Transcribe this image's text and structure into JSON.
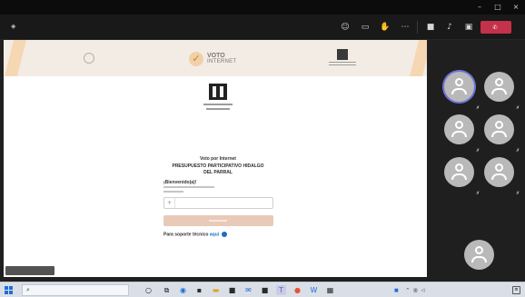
{
  "titlebar": {
    "title": "",
    "minimize": "–",
    "maximize": "□",
    "close": "×"
  },
  "toolbar": {
    "timer": "",
    "icons": [
      "people-icon",
      "chat-icon",
      "reactions-icon",
      "more-icon",
      "camera-icon",
      "mic-icon",
      "share-icon"
    ],
    "leave_label": ""
  },
  "site": {
    "logo_left_text": "",
    "logo_center_line1": "VOTO",
    "logo_center_highlight": "",
    "logo_center_line2": "INTERNET",
    "heading_small": "Voto por Internet",
    "heading_big_1": "PRESUPUESTO PARTICIPATIVO HIDALGO",
    "heading_big_2": "DEL PARRAL",
    "welcome": "¡Bienvenido(a)!",
    "input_placeholder": "",
    "help_text": "Para soporte técnico",
    "help_link": "aquí"
  },
  "presenter": {
    "name": ""
  },
  "participants": [
    {
      "name": "",
      "active": true
    },
    {
      "name": "",
      "active": false
    },
    {
      "name": "",
      "active": false
    },
    {
      "name": "",
      "active": false
    },
    {
      "name": "",
      "active": false
    },
    {
      "name": "",
      "active": false
    },
    {
      "name": "",
      "active": false
    }
  ],
  "taskbar": {
    "search_placeholder": "",
    "weather": "",
    "language": "",
    "time": "",
    "date": ""
  },
  "colors": {
    "leave_button": "#c4314b",
    "accent_blue": "#1b6ec2",
    "voto_orange": "#d08a3c",
    "active_ring": "#6f74d6"
  }
}
